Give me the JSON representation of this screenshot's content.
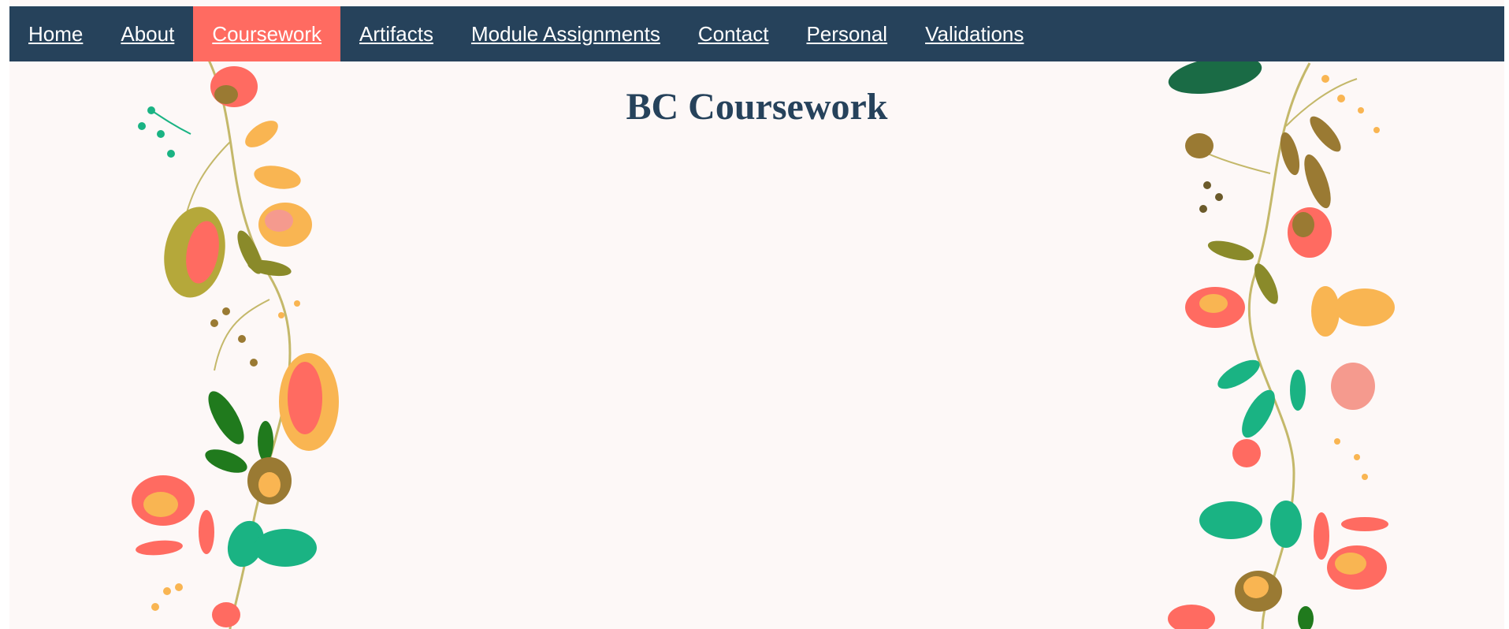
{
  "nav": {
    "items": [
      {
        "label": "Home",
        "active": false
      },
      {
        "label": "About",
        "active": false
      },
      {
        "label": "Coursework",
        "active": true
      },
      {
        "label": "Artifacts",
        "active": false
      },
      {
        "label": "Module Assignments",
        "active": false
      },
      {
        "label": "Contact",
        "active": false
      },
      {
        "label": "Personal",
        "active": false
      },
      {
        "label": "Validations",
        "active": false
      }
    ]
  },
  "page": {
    "title": "BC Coursework"
  },
  "colors": {
    "navbar": "#26425b",
    "active_tab": "#ff6b61",
    "title": "#26425b",
    "page_background": "#fdf8f7",
    "floral_palette": [
      "#ff6b61",
      "#f9b552",
      "#1ab383",
      "#207a1d",
      "#9a7a33",
      "#b5a83a",
      "#f59a8e"
    ]
  }
}
